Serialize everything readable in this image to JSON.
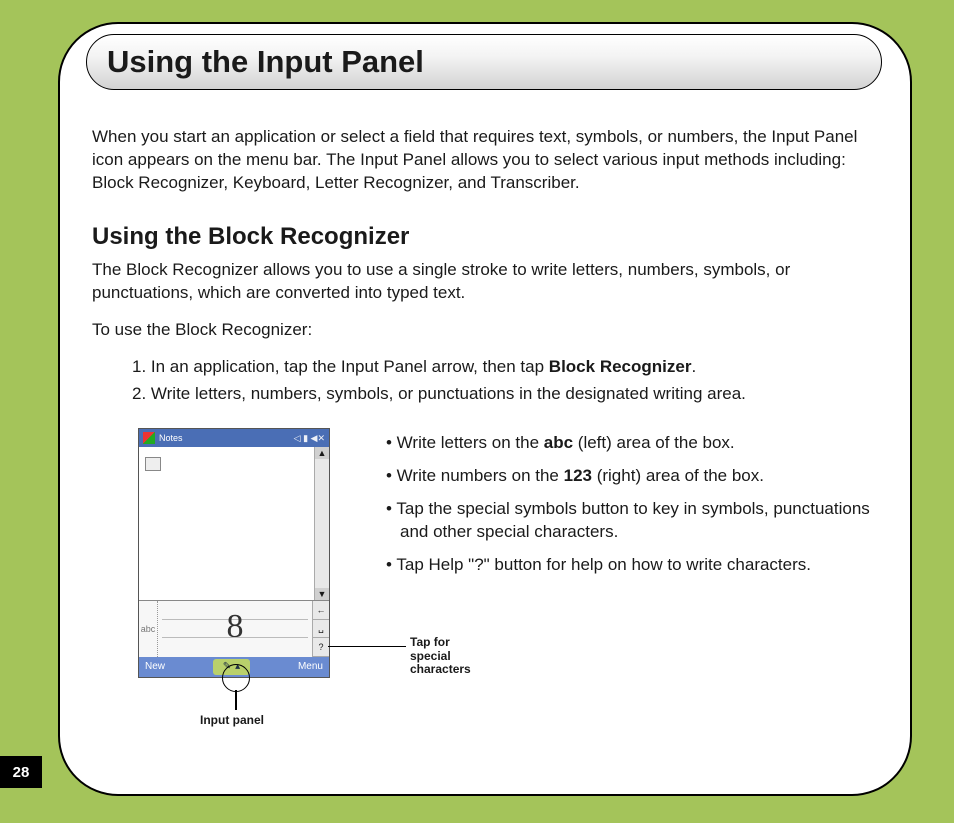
{
  "page_number": "28",
  "title": "Using the Input Panel",
  "intro": "When you start an application or select a field that requires text, symbols, or numbers, the Input Panel icon appears on the menu bar. The Input Panel allows you to select various input methods including: Block Recognizer, Keyboard, Letter Recognizer, and Transcriber.",
  "section_heading": "Using the Block Recognizer",
  "section_intro": "The Block Recognizer allows you to use a single stroke to write letters, numbers, symbols, or punctuations, which are converted into typed text.",
  "lead_in": "To use the Block Recognizer:",
  "steps": {
    "one_prefix": "1. In an application, tap the Input Panel arrow, then tap ",
    "one_bold": "Block Recognizer",
    "one_suffix": ".",
    "two": "2. Write letters, numbers, symbols, or punctuations in the designated writing area."
  },
  "bullets": {
    "b1_prefix": "• Write letters on the ",
    "b1_bold": "abc",
    "b1_suffix": " (left) area of the box.",
    "b2_prefix": "• Write numbers on the ",
    "b2_bold": "123",
    "b2_suffix": " (right) area of the box.",
    "b3": "• Tap the special symbols button to key in symbols, punctuations and other special characters.",
    "b4": "• Tap Help \"?\" button for help on how to write characters."
  },
  "callouts": {
    "input_panel": "Input panel",
    "special_chars": "Tap for special characters"
  },
  "pda": {
    "title": "Notes",
    "status_icons": "◁ ▮ ◀✕",
    "ime_left_label": "abc",
    "ime_sample_char": "8",
    "side_btn_back": "←",
    "side_btn_space": "␣",
    "side_btn_help": "?",
    "bottom_left": "New",
    "bottom_mid_icon": "✎",
    "bottom_mid_arrow": "▴",
    "bottom_right": "Menu"
  }
}
